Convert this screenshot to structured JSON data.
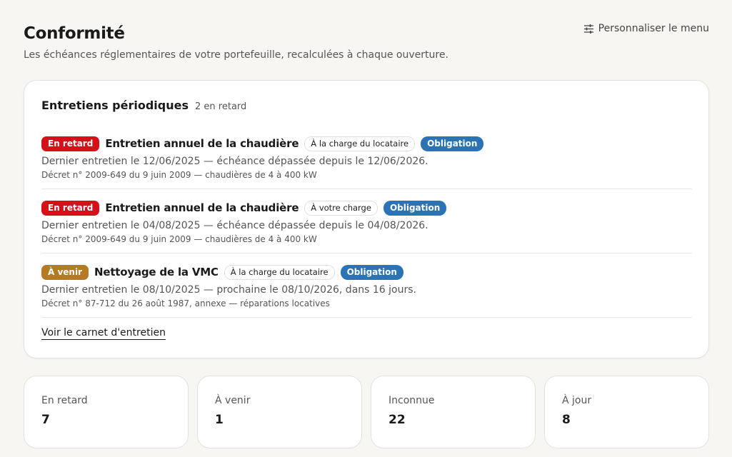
{
  "header": {
    "title": "Conformité",
    "subtitle": "Les échéances réglementaires de votre portefeuille, recalculées à chaque ouverture.",
    "customize_label": "Personnaliser le menu",
    "customize_icon": "sliders-icon"
  },
  "maintenance": {
    "title": "Entretiens périodiques",
    "count_label": "2 en retard",
    "items": [
      {
        "status": "En retard",
        "status_color": "#d60f19",
        "title": "Entretien annuel de la chaudière",
        "charge": "À la charge du locataire",
        "type": "Obligation",
        "description": "Dernier entretien le 12/06/2025 — échéance dépassée depuis le 12/06/2026.",
        "reference": "Décret n° 2009-649 du 9 juin 2009 — chaudières de 4 à 400 kW"
      },
      {
        "status": "En retard",
        "status_color": "#d60f19",
        "title": "Entretien annuel de la chaudière",
        "charge": "À votre charge",
        "type": "Obligation",
        "description": "Dernier entretien le 04/08/2025 — échéance dépassée depuis le 04/08/2026.",
        "reference": "Décret n° 2009-649 du 9 juin 2009 — chaudières de 4 à 400 kW"
      },
      {
        "status": "À venir",
        "status_color": "#b67a24",
        "title": "Nettoyage de la VMC",
        "charge": "À la charge du locataire",
        "type": "Obligation",
        "description": "Dernier entretien le 08/10/2025 — prochaine le 08/10/2026, dans 16 jours.",
        "reference": "Décret n° 87-712 du 26 août 1987, annexe — réparations locatives"
      }
    ],
    "link_label": "Voir le carnet d'entretien"
  },
  "stats": [
    {
      "label": "En retard",
      "value": "7"
    },
    {
      "label": "À venir",
      "value": "1"
    },
    {
      "label": "Inconnue",
      "value": "22"
    },
    {
      "label": "À jour",
      "value": "8"
    }
  ],
  "colors": {
    "background": "#f8f6f3",
    "late": "#d60f19",
    "upcoming": "#b67a24",
    "obligation": "#2b73b4"
  }
}
